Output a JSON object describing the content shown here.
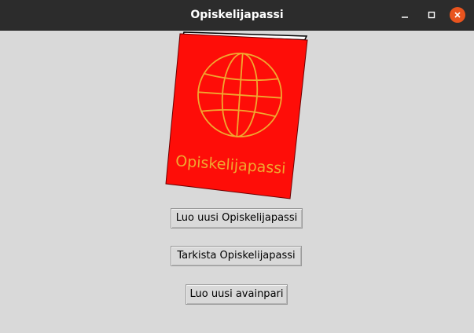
{
  "window": {
    "title": "Opiskelijapassi",
    "controls": {
      "minimize_icon": "minimize-icon",
      "maximize_icon": "maximize-icon",
      "close_icon": "close-icon"
    }
  },
  "illustration": {
    "passport_text": "Opiskelijapassi",
    "cover_color": "#fe0d08",
    "emblem_color": "#f0a830"
  },
  "buttons": {
    "create_passport": "Luo uusi Opiskelijapassi",
    "check_passport": "Tarkista Opiskelijapassi",
    "create_keypair": "Luo uusi avainpari"
  }
}
